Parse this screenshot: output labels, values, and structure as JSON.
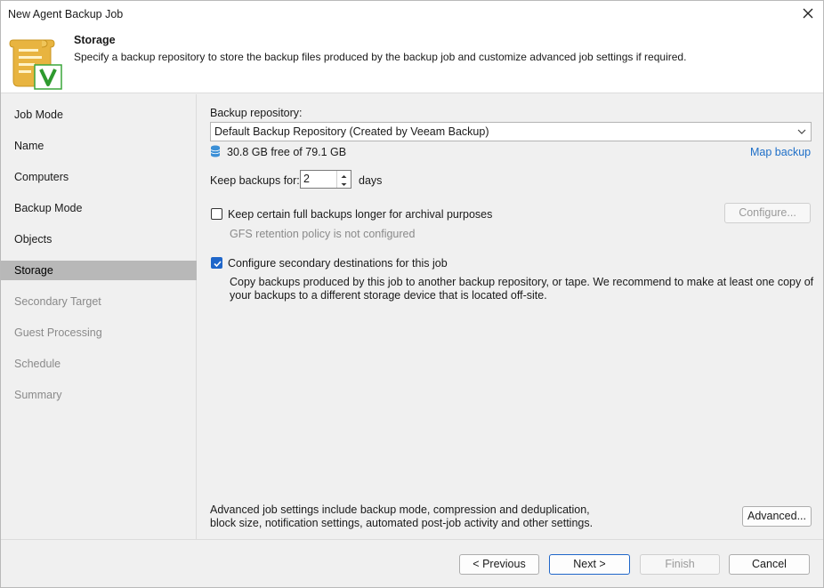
{
  "window": {
    "title": "New Agent Backup Job",
    "close_icon": "close-icon"
  },
  "header": {
    "title": "Storage",
    "description": "Specify a backup repository to store the backup files produced by the backup job and customize advanced job settings if required.",
    "logo_icon": "scroll-check-icon"
  },
  "nav": {
    "items": [
      {
        "label": "Job Mode",
        "state": "normal"
      },
      {
        "label": "Name",
        "state": "normal"
      },
      {
        "label": "Computers",
        "state": "normal"
      },
      {
        "label": "Backup Mode",
        "state": "normal"
      },
      {
        "label": "Objects",
        "state": "normal"
      },
      {
        "label": "Storage",
        "state": "active"
      },
      {
        "label": "Secondary Target",
        "state": "disabled"
      },
      {
        "label": "Guest Processing",
        "state": "disabled"
      },
      {
        "label": "Schedule",
        "state": "disabled"
      },
      {
        "label": "Summary",
        "state": "disabled"
      }
    ]
  },
  "storage": {
    "repository_label": "Backup repository:",
    "repository_value": "Default Backup Repository (Created by Veeam Backup)",
    "free_space": "30.8 GB free of 79.1 GB",
    "map_backup": "Map backup",
    "keep_label": "Keep backups for:",
    "keep_value": "2",
    "keep_unit": "days",
    "archival_label": "Keep certain full backups longer for archival purposes",
    "archival_checked": false,
    "configure_button": "Configure...",
    "gfs_status": "GFS retention policy is not configured",
    "secondary_label": "Configure secondary destinations for this job",
    "secondary_checked": true,
    "secondary_desc_1": "Copy backups produced by this job to another backup repository, or tape. We recommend to make at least one copy of",
    "secondary_desc_2": "your backups to a different storage device that is located off-site.",
    "advanced_desc_1": "Advanced job settings include backup mode, compression and deduplication,",
    "advanced_desc_2": "block size, notification settings, automated post-job activity and other settings.",
    "advanced_button": "Advanced..."
  },
  "footer": {
    "previous": "< Previous",
    "next": "Next >",
    "finish": "Finish",
    "cancel": "Cancel"
  },
  "colors": {
    "accent": "#1f66c9",
    "link": "#1e6fc8",
    "nav_active": "#b8b8b8"
  }
}
